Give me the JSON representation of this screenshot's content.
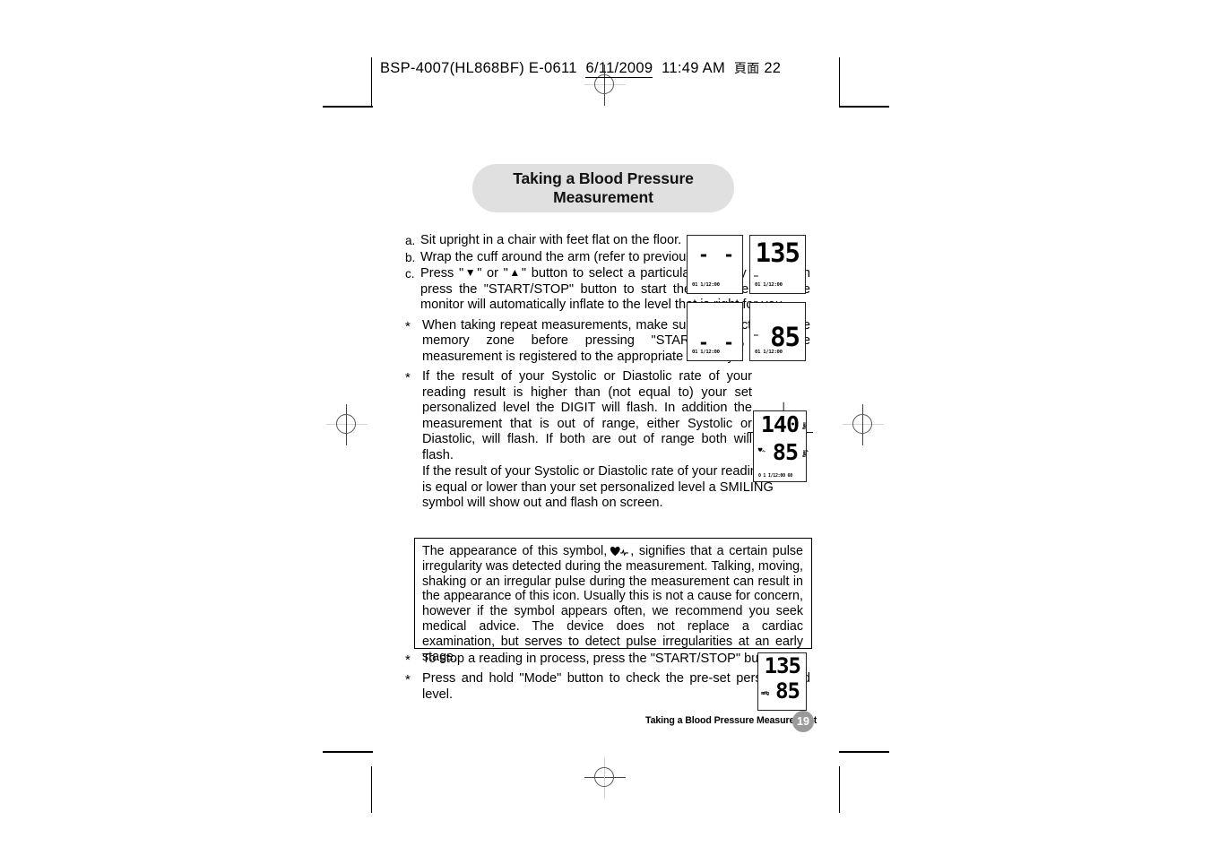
{
  "slug": {
    "filename": "BSP-4007(HL868BF) E-0611",
    "date": "6/11/2009",
    "time": "11:49 AM",
    "page_label_cjk": "頁面",
    "page_label_number": "22"
  },
  "title": "Taking a Blood Pressure Measurement",
  "steps": [
    {
      "marker": "a.",
      "text": "Sit upright in a chair with feet flat on the floor."
    },
    {
      "marker": "b.",
      "text": "Wrap the cuff around the arm (refer to previous page)"
    },
    {
      "marker": "c.",
      "text_pre": "Press \"",
      "sym1": "▼",
      "text_mid": "\" or \"",
      "sym2": "▲",
      "text_post": "\" button to select a particular memory zone then press the \"START/STOP\" button to start the measurement. The monitor will automatically inflate to the level that is right for you."
    }
  ],
  "notes": [
    {
      "marker": "*",
      "text": "When taking repeat measurements, make sure to select the same memory zone before pressing \"START/STOP\", so the measurement is registered to the appropriate memory."
    },
    {
      "marker": "*",
      "text": "If the result of your Systolic or Diastolic rate of your reading result is higher than (not equal to) your set personalized level the DIGIT will flash. In addition the measurement that is out of range, either Systolic or Diastolic, will flash. If both are out of range both will flash.",
      "text2": "If the result of your Systolic or Diastolic rate of your reading result is equal or lower than your set personalized level a SMILING symbol will show out and flash on screen."
    }
  ],
  "note_box": {
    "part1": "The appearance of this symbol,",
    "symbol_name": "heart-pulse-icon",
    "part2": ", signifies that a certain pulse irregularity was detected during the measurement. Talking, moving, shaking or an irregular pulse during the measurement can result in the appearance of this icon. Usually this is not a cause for concern, however if the symbol appears often, we recommend you seek medical advice. The device does not replace a cardiac examination, but serves to detect pulse irregularities at an early stage."
  },
  "notes_bottom": [
    {
      "marker": "*",
      "text": "To stop a reading in process, press the \"START/STOP\" button."
    },
    {
      "marker": "*",
      "text": "Press and hold \"Mode\" button to check the pre-set personalized level."
    }
  ],
  "lcd_panels": {
    "top_left": {
      "value": "- -",
      "datetime": "01 1/12:00"
    },
    "top_right": {
      "value": "135",
      "datetime": "01 1/12:00",
      "unit_mark": "—"
    },
    "bottom_left": {
      "value": "- -",
      "datetime": "01 1/12:00"
    },
    "bottom_right": {
      "value": "85",
      "datetime": "01 1/12:00",
      "unit_mark": "—"
    },
    "flashing": {
      "systolic": "140",
      "diastolic": "85",
      "sys_unit": "mmHg",
      "dia_unit": "mmHg",
      "bottom_row": "0 1 I/12:00  60"
    },
    "preset": {
      "systolic": "135",
      "diastolic": "85",
      "unit_mark": "mmHg"
    }
  },
  "footer": {
    "text": "Taking a Blood Pressure Measurement",
    "page": "19"
  },
  "colors": {
    "title_pill_bg": "#e0e0e0",
    "page_circle_bg": "#9a9a9a",
    "text": "#000000"
  }
}
